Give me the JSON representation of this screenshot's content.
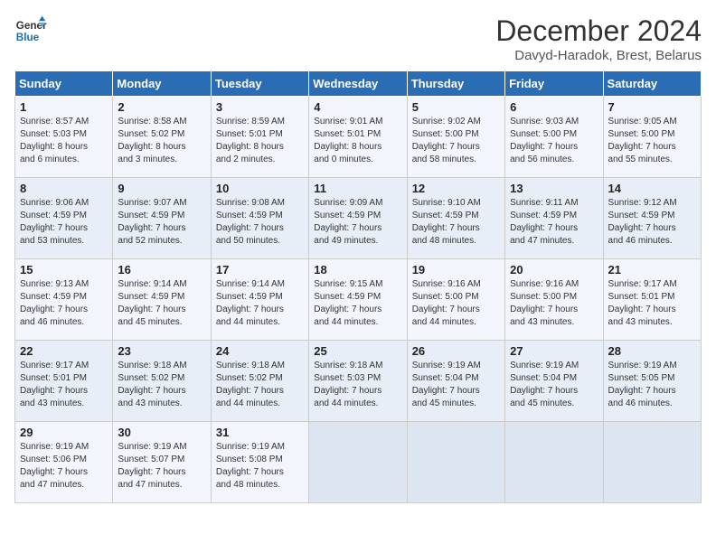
{
  "header": {
    "logo_line1": "General",
    "logo_line2": "Blue",
    "month_year": "December 2024",
    "location": "Davyd-Haradok, Brest, Belarus"
  },
  "days_of_week": [
    "Sunday",
    "Monday",
    "Tuesday",
    "Wednesday",
    "Thursday",
    "Friday",
    "Saturday"
  ],
  "weeks": [
    [
      {
        "day": "1",
        "content": "Sunrise: 8:57 AM\nSunset: 5:03 PM\nDaylight: 8 hours\nand 6 minutes."
      },
      {
        "day": "2",
        "content": "Sunrise: 8:58 AM\nSunset: 5:02 PM\nDaylight: 8 hours\nand 3 minutes."
      },
      {
        "day": "3",
        "content": "Sunrise: 8:59 AM\nSunset: 5:01 PM\nDaylight: 8 hours\nand 2 minutes."
      },
      {
        "day": "4",
        "content": "Sunrise: 9:01 AM\nSunset: 5:01 PM\nDaylight: 8 hours\nand 0 minutes."
      },
      {
        "day": "5",
        "content": "Sunrise: 9:02 AM\nSunset: 5:00 PM\nDaylight: 7 hours\nand 58 minutes."
      },
      {
        "day": "6",
        "content": "Sunrise: 9:03 AM\nSunset: 5:00 PM\nDaylight: 7 hours\nand 56 minutes."
      },
      {
        "day": "7",
        "content": "Sunrise: 9:05 AM\nSunset: 5:00 PM\nDaylight: 7 hours\nand 55 minutes."
      }
    ],
    [
      {
        "day": "8",
        "content": "Sunrise: 9:06 AM\nSunset: 4:59 PM\nDaylight: 7 hours\nand 53 minutes."
      },
      {
        "day": "9",
        "content": "Sunrise: 9:07 AM\nSunset: 4:59 PM\nDaylight: 7 hours\nand 52 minutes."
      },
      {
        "day": "10",
        "content": "Sunrise: 9:08 AM\nSunset: 4:59 PM\nDaylight: 7 hours\nand 50 minutes."
      },
      {
        "day": "11",
        "content": "Sunrise: 9:09 AM\nSunset: 4:59 PM\nDaylight: 7 hours\nand 49 minutes."
      },
      {
        "day": "12",
        "content": "Sunrise: 9:10 AM\nSunset: 4:59 PM\nDaylight: 7 hours\nand 48 minutes."
      },
      {
        "day": "13",
        "content": "Sunrise: 9:11 AM\nSunset: 4:59 PM\nDaylight: 7 hours\nand 47 minutes."
      },
      {
        "day": "14",
        "content": "Sunrise: 9:12 AM\nSunset: 4:59 PM\nDaylight: 7 hours\nand 46 minutes."
      }
    ],
    [
      {
        "day": "15",
        "content": "Sunrise: 9:13 AM\nSunset: 4:59 PM\nDaylight: 7 hours\nand 46 minutes."
      },
      {
        "day": "16",
        "content": "Sunrise: 9:14 AM\nSunset: 4:59 PM\nDaylight: 7 hours\nand 45 minutes."
      },
      {
        "day": "17",
        "content": "Sunrise: 9:14 AM\nSunset: 4:59 PM\nDaylight: 7 hours\nand 44 minutes."
      },
      {
        "day": "18",
        "content": "Sunrise: 9:15 AM\nSunset: 4:59 PM\nDaylight: 7 hours\nand 44 minutes."
      },
      {
        "day": "19",
        "content": "Sunrise: 9:16 AM\nSunset: 5:00 PM\nDaylight: 7 hours\nand 44 minutes."
      },
      {
        "day": "20",
        "content": "Sunrise: 9:16 AM\nSunset: 5:00 PM\nDaylight: 7 hours\nand 43 minutes."
      },
      {
        "day": "21",
        "content": "Sunrise: 9:17 AM\nSunset: 5:01 PM\nDaylight: 7 hours\nand 43 minutes."
      }
    ],
    [
      {
        "day": "22",
        "content": "Sunrise: 9:17 AM\nSunset: 5:01 PM\nDaylight: 7 hours\nand 43 minutes."
      },
      {
        "day": "23",
        "content": "Sunrise: 9:18 AM\nSunset: 5:02 PM\nDaylight: 7 hours\nand 43 minutes."
      },
      {
        "day": "24",
        "content": "Sunrise: 9:18 AM\nSunset: 5:02 PM\nDaylight: 7 hours\nand 44 minutes."
      },
      {
        "day": "25",
        "content": "Sunrise: 9:18 AM\nSunset: 5:03 PM\nDaylight: 7 hours\nand 44 minutes."
      },
      {
        "day": "26",
        "content": "Sunrise: 9:19 AM\nSunset: 5:04 PM\nDaylight: 7 hours\nand 45 minutes."
      },
      {
        "day": "27",
        "content": "Sunrise: 9:19 AM\nSunset: 5:04 PM\nDaylight: 7 hours\nand 45 minutes."
      },
      {
        "day": "28",
        "content": "Sunrise: 9:19 AM\nSunset: 5:05 PM\nDaylight: 7 hours\nand 46 minutes."
      }
    ],
    [
      {
        "day": "29",
        "content": "Sunrise: 9:19 AM\nSunset: 5:06 PM\nDaylight: 7 hours\nand 47 minutes."
      },
      {
        "day": "30",
        "content": "Sunrise: 9:19 AM\nSunset: 5:07 PM\nDaylight: 7 hours\nand 47 minutes."
      },
      {
        "day": "31",
        "content": "Sunrise: 9:19 AM\nSunset: 5:08 PM\nDaylight: 7 hours\nand 48 minutes."
      },
      {
        "day": "",
        "content": ""
      },
      {
        "day": "",
        "content": ""
      },
      {
        "day": "",
        "content": ""
      },
      {
        "day": "",
        "content": ""
      }
    ]
  ]
}
